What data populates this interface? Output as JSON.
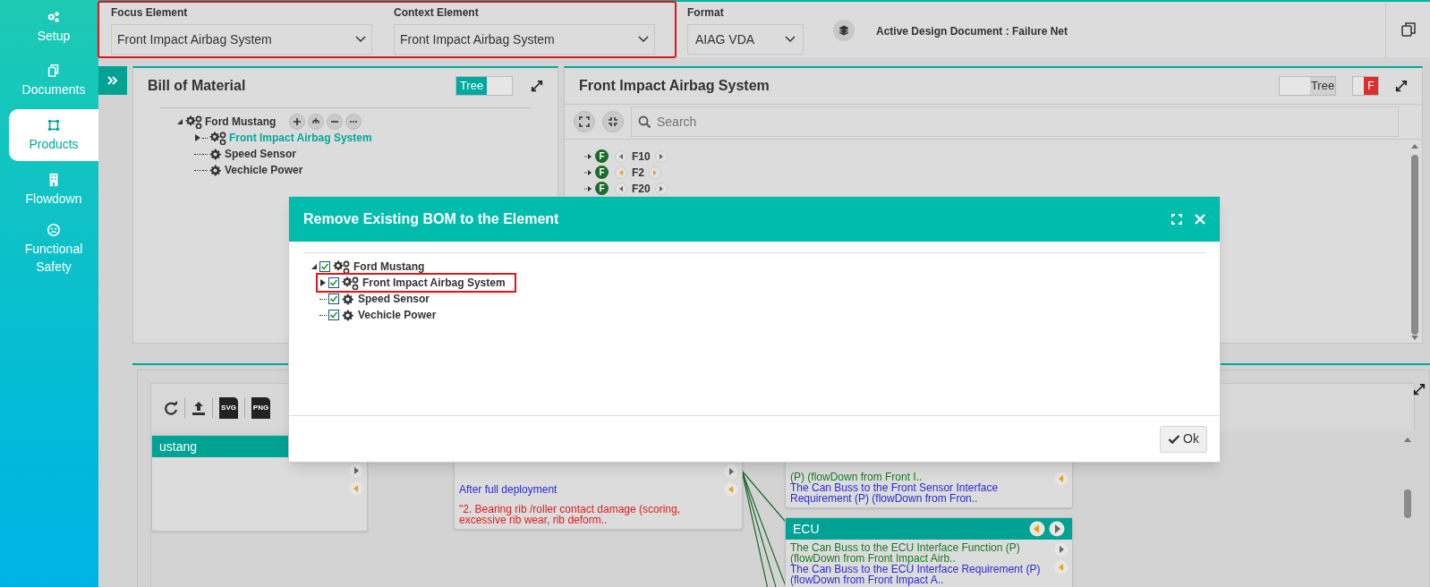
{
  "sidebar": {
    "items": [
      {
        "label": "Setup",
        "selected": false
      },
      {
        "label": "Documents",
        "selected": false
      },
      {
        "label": "Products",
        "selected": true
      },
      {
        "label": "Flowdown",
        "selected": false
      },
      {
        "label": "Functional Safety",
        "selected": false
      }
    ]
  },
  "header": {
    "highlighted": true,
    "focus_element": {
      "label": "Focus Element",
      "value": "Front Impact Airbag System"
    },
    "context_element": {
      "label": "Context Element",
      "value": "Front Impact Airbag System"
    },
    "format": {
      "label": "Format",
      "value": "AIAG VDA"
    },
    "active_document": "Active Design Document : Failure Net"
  },
  "bom_panel": {
    "title": "Bill of Material",
    "toggle": {
      "label": "Tree",
      "on": true
    },
    "tree": [
      {
        "label": "Ford Mustang",
        "kind": "assembly",
        "selected": false,
        "expanded": true,
        "children": [
          {
            "label": "Front Impact Airbag System",
            "kind": "assembly",
            "selected": true,
            "expanded": false
          },
          {
            "label": "Speed Sensor",
            "kind": "part",
            "selected": false
          },
          {
            "label": "Vechicle Power",
            "kind": "part",
            "selected": false
          }
        ]
      }
    ]
  },
  "structure_panel": {
    "title": "Front Impact Airbag System",
    "toggle": {
      "label": "Tree",
      "on": false
    },
    "filter": {
      "label": "F",
      "on": true
    },
    "search": {
      "placeholder": "Search"
    },
    "rows": [
      {
        "badge": "F",
        "label": "F10",
        "highlighted": false
      },
      {
        "badge": "F",
        "label": "F2",
        "highlighted": true
      },
      {
        "badge": "F",
        "label": "F20",
        "highlighted": false
      }
    ]
  },
  "net_panel": {
    "toolbar": {
      "file_exports": [
        "SVG",
        "PNG"
      ]
    },
    "nodes": [
      {
        "title": "ustang"
      },
      {
        "entries": [
          {
            "kind": "requirement",
            "text": "After full deployment"
          },
          {
            "kind": "failure",
            "text": "\"2. Bearing rib /roller contact damage (scoring, excessive rib wear, rib deform.."
          }
        ]
      },
      {
        "entries": [
          {
            "kind": "function",
            "text": "(P) (flowDown from Front I.."
          },
          {
            "kind": "requirement",
            "text": "The Can Buss to the Front Sensor Interface Requirement (P) (flowDown from Fron.."
          }
        ]
      },
      {
        "title": "ECU",
        "entries": [
          {
            "kind": "function",
            "text": "The Can Buss to the ECU Interface Function (P) (flowDown from Front Impact Airb.."
          },
          {
            "kind": "requirement",
            "text": "The Can Buss to the ECU Interface Requirement (P) (flowDown from Front Impact A.."
          }
        ]
      }
    ]
  },
  "dialog": {
    "title": "Remove Existing BOM to the Element",
    "tree": [
      {
        "label": "Ford Mustang",
        "kind": "assembly",
        "checked": true,
        "highlighted": false,
        "expanded": true,
        "children": [
          {
            "label": "Front Impact Airbag System",
            "kind": "assembly",
            "checked": true,
            "highlighted": true,
            "expanded": false
          },
          {
            "label": "Speed Sensor",
            "kind": "part",
            "checked": true,
            "highlighted": false
          },
          {
            "label": "Vechicle Power",
            "kind": "part",
            "checked": true,
            "highlighted": false
          }
        ]
      }
    ],
    "ok_button": "Ok"
  }
}
